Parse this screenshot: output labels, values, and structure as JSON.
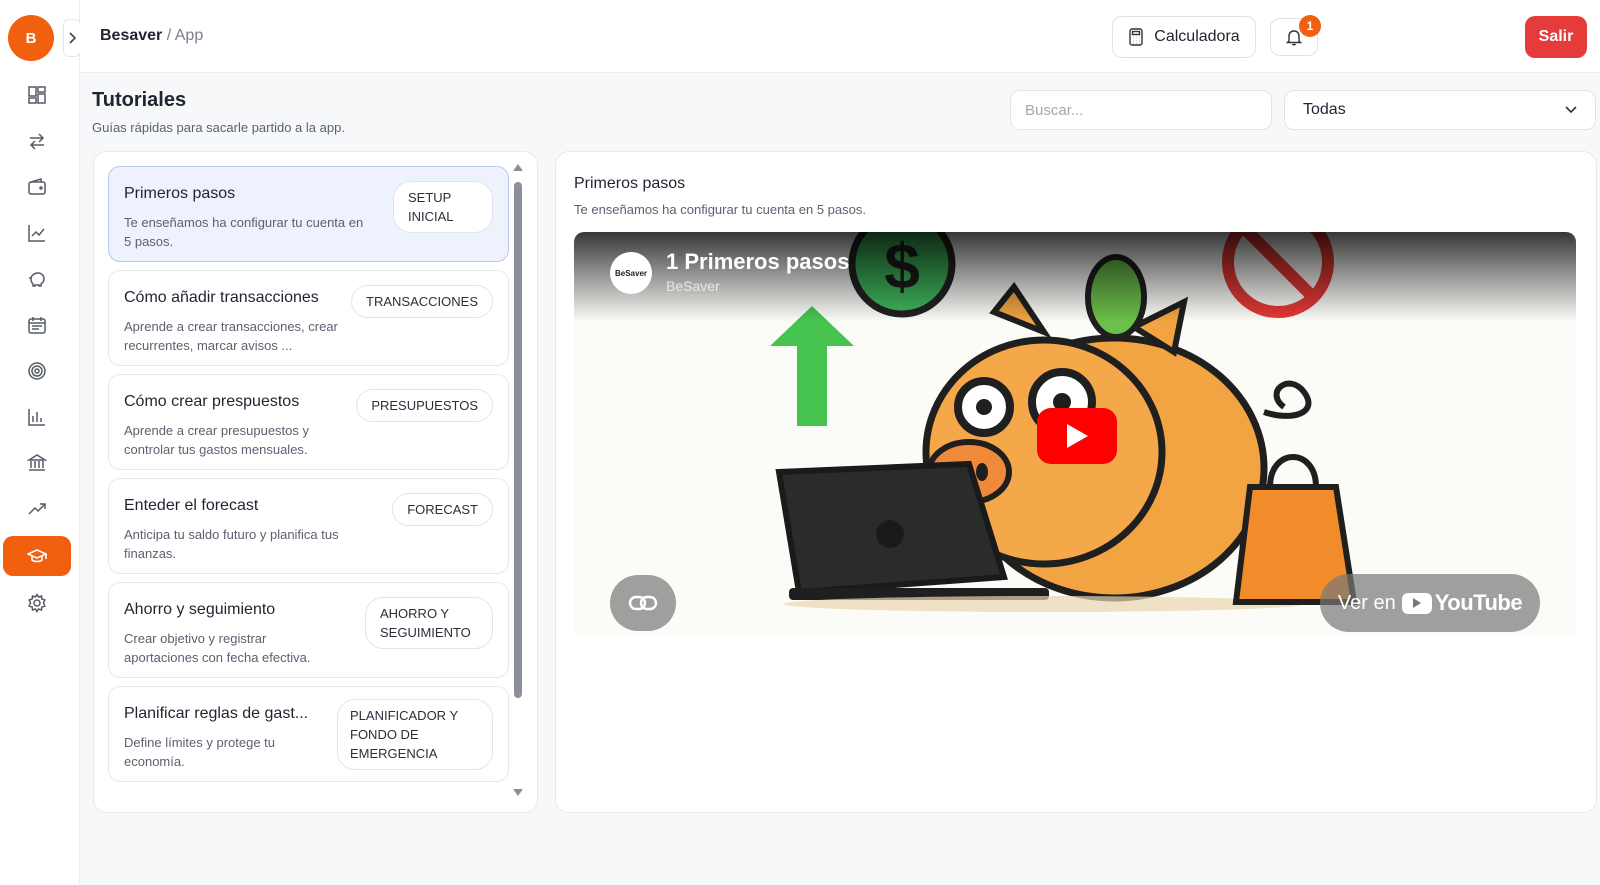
{
  "app": {
    "logo_letter": "B",
    "accent_color": "#f0600f",
    "danger_color": "#e63b3b"
  },
  "header": {
    "breadcrumb": {
      "app": "Besaver",
      "separator": "/",
      "page": "App"
    },
    "calculator_label": "Calculadora",
    "notification_count": "1",
    "logout_label": "Salir"
  },
  "sidebar": {
    "items": [
      {
        "icon": "dashboard-icon",
        "active": false
      },
      {
        "icon": "transfer-arrows-icon",
        "active": false
      },
      {
        "icon": "wallet-icon",
        "active": false
      },
      {
        "icon": "line-chart-icon",
        "active": false
      },
      {
        "icon": "piggy-bank-icon",
        "active": false
      },
      {
        "icon": "calendar-icon",
        "active": false
      },
      {
        "icon": "target-icon",
        "active": false
      },
      {
        "icon": "bar-chart-icon",
        "active": false
      },
      {
        "icon": "bank-icon",
        "active": false
      },
      {
        "icon": "trending-up-icon",
        "active": false
      },
      {
        "icon": "graduation-cap-icon",
        "active": true
      },
      {
        "icon": "gear-icon",
        "active": false
      }
    ]
  },
  "page": {
    "title": "Tutoriales",
    "subtitle": "Guías rápidas para sacarle partido a la app.",
    "search_placeholder": "Buscar...",
    "filter_value": "Todas"
  },
  "tutorials": [
    {
      "title": "Primeros pasos",
      "description": "Te enseñamos ha configurar tu cuenta en 5 pasos.",
      "tag": "SETUP INICIAL",
      "selected": true
    },
    {
      "title": "Cómo añadir transacciones",
      "description": "Aprende a crear transacciones, crear recurrentes, marcar avisos ...",
      "tag": "TRANSACCIONES",
      "selected": false
    },
    {
      "title": "Cómo crear prespuestos",
      "description": "Aprende a crear presupuestos y controlar tus gastos mensuales.",
      "tag": "PRESUPUESTOS",
      "selected": false
    },
    {
      "title": "Enteder el forecast",
      "description": "Anticipa tu saldo futuro y planifica tus finanzas.",
      "tag": "FORECAST",
      "selected": false
    },
    {
      "title": "Ahorro y seguimiento",
      "description": "Crear objetivo y registrar aportaciones con fecha efectiva.",
      "tag": "AHORRO Y SEGUIMIENTO",
      "selected": false
    },
    {
      "title": "Planificar reglas de gast...",
      "description": "Define límites y protege tu economía.",
      "tag": "PLANIFICADOR Y FONDO DE EMERGENCIA",
      "selected": false
    }
  ],
  "detail": {
    "title": "Primeros pasos",
    "description": "Te enseñamos ha configurar tu cuenta en 5 pasos.",
    "video": {
      "title": "1 Primeros pasos",
      "channel": "BeSaver",
      "channel_avatar_text": "BeSaver",
      "watch_on_label": "Ver en",
      "youtube_label": "YouTube"
    }
  }
}
